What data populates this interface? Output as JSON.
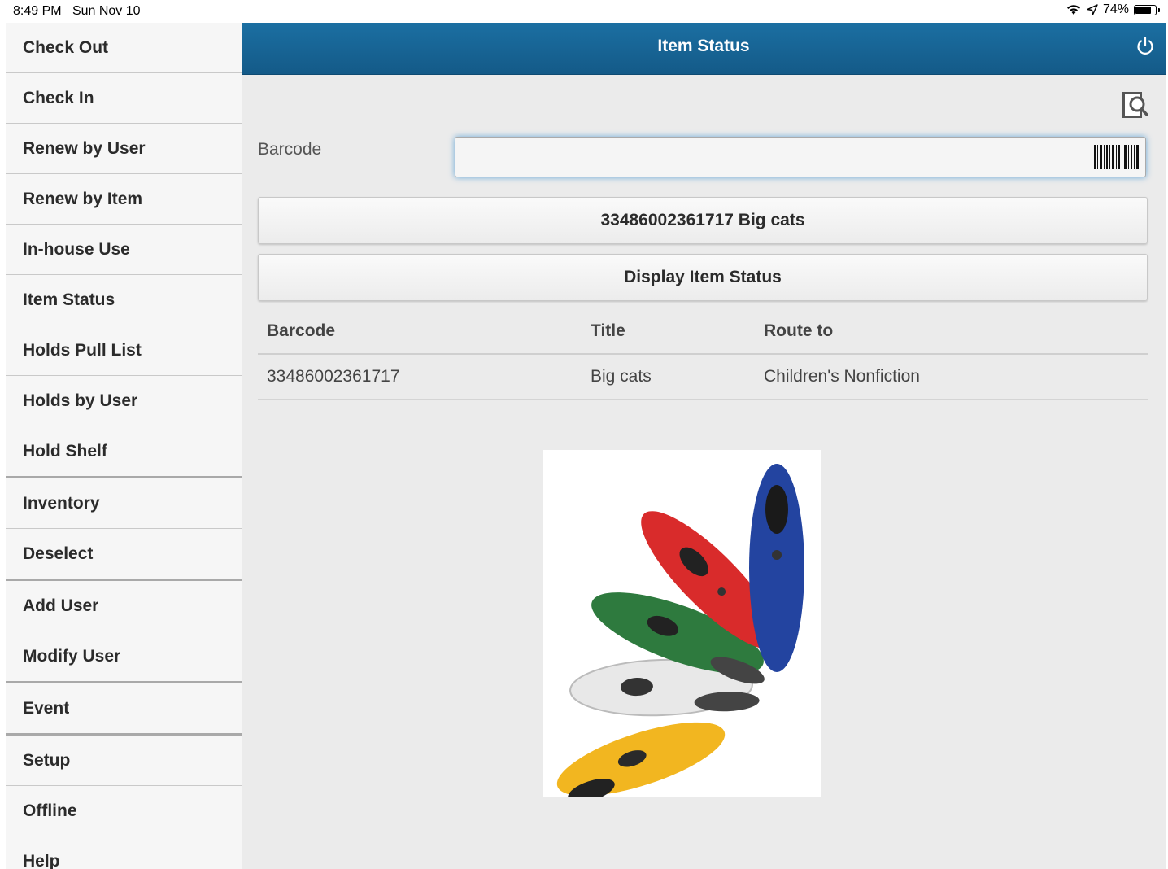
{
  "status_bar": {
    "time": "8:49 PM",
    "date": "Sun Nov 10",
    "battery": "74%"
  },
  "sidebar": {
    "items": [
      {
        "label": "Check Out"
      },
      {
        "label": "Check In"
      },
      {
        "label": "Renew by User"
      },
      {
        "label": "Renew by Item"
      },
      {
        "label": "In-house Use"
      },
      {
        "label": "Item Status"
      },
      {
        "label": "Holds Pull List"
      },
      {
        "label": "Holds by User"
      },
      {
        "label": "Hold Shelf"
      },
      {
        "label": "Inventory"
      },
      {
        "label": "Deselect"
      },
      {
        "label": "Add User"
      },
      {
        "label": "Modify User"
      },
      {
        "label": "Event"
      },
      {
        "label": "Setup"
      },
      {
        "label": "Offline"
      },
      {
        "label": "Help"
      }
    ]
  },
  "header": {
    "title": "Item Status"
  },
  "form": {
    "barcode_label": "Barcode",
    "barcode_value": "",
    "selected_item_button": "33486002361717 Big cats",
    "display_button": "Display Item Status"
  },
  "table": {
    "headers": {
      "barcode": "Barcode",
      "title": "Title",
      "route": "Route to"
    },
    "rows": [
      {
        "barcode": "33486002361717",
        "title": "Big cats",
        "route": "Children's Nonfiction"
      }
    ]
  },
  "colors": {
    "header": "#1b6fa2",
    "sidebar_bg": "#f6f6f6",
    "main_bg": "#ebebeb"
  }
}
